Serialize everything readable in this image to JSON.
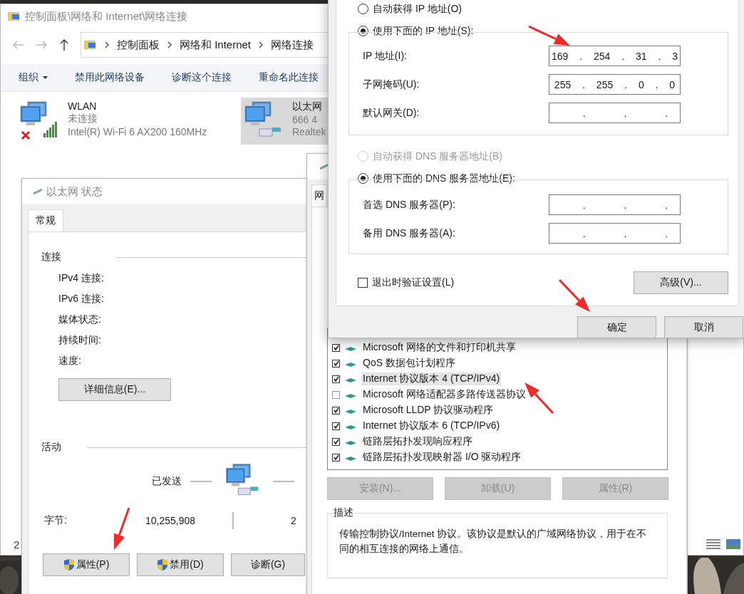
{
  "explorer": {
    "title": "控制面板\\网络和 Internet\\网络连接",
    "breadcrumb": [
      "控制面板",
      "网络和 Internet",
      "网络连接"
    ],
    "toolbar": [
      {
        "label": "组织",
        "kind": "menu"
      },
      {
        "label": "禁用此网络设备",
        "kind": "action"
      },
      {
        "label": "诊断这个连接",
        "kind": "action"
      },
      {
        "label": "重命名此连接",
        "kind": "action"
      }
    ],
    "connections": [
      {
        "name": "WLAN",
        "status": "未连接",
        "device": "Intel(R) Wi-Fi 6 AX200 160MHz",
        "kind": "wireless",
        "connected": false,
        "selected": false
      },
      {
        "name": "以太网",
        "status": "666 4",
        "device": "Realtek",
        "kind": "wired",
        "connected": true,
        "selected": true
      }
    ],
    "status_fragment": "2"
  },
  "status_window": {
    "title": "以太网 状态",
    "tabs": [
      {
        "label": "常规",
        "selected": true
      }
    ],
    "connection_group": "连接",
    "fields": [
      "IPv4 连接:",
      "IPv6 连接:",
      "媒体状态:",
      "持续时间:",
      "速度:"
    ],
    "details_button": "详细信息(E)...",
    "activity_group": "活动",
    "sent_label": "已发送",
    "bytes_label": "字节:",
    "bytes_sent": "10,255,908",
    "bytes_received": "2",
    "buttons": [
      {
        "label": "属性(P)",
        "shield": true
      },
      {
        "label": "禁用(D)",
        "shield": true
      },
      {
        "label": "诊断(G)",
        "shield": false
      }
    ]
  },
  "properties_window": {
    "tab_fragment": "网",
    "components": [
      {
        "label": "Microsoft 网络的文件和打印机共享",
        "checked": true,
        "selected": false
      },
      {
        "label": "QoS 数据包计划程序",
        "checked": true,
        "selected": false
      },
      {
        "label": "Internet 协议版本 4 (TCP/IPv4)",
        "checked": true,
        "selected": true
      },
      {
        "label": "Microsoft 网络适配器多路传送器协议",
        "checked": false,
        "selected": false
      },
      {
        "label": "Microsoft LLDP 协议驱动程序",
        "checked": true,
        "selected": false
      },
      {
        "label": "Internet 协议版本 6 (TCP/IPv6)",
        "checked": true,
        "selected": false
      },
      {
        "label": "链路层拓扑发现响应程序",
        "checked": true,
        "selected": false
      },
      {
        "label": "链路层拓扑发现映射器 I/O 驱动程序",
        "checked": true,
        "selected": false
      }
    ],
    "buttons": [
      {
        "label": "安装(N)...",
        "disabled": true
      },
      {
        "label": "卸载(U)",
        "disabled": true
      },
      {
        "label": "属性(R)",
        "disabled": true
      }
    ],
    "description_group": "描述",
    "description": "传输控制协议/Internet 协议。该协议是默认的广域网络协议，用于在不同的相互连接的网络上通信。"
  },
  "ip_dialog": {
    "ip_radios": [
      {
        "label": "自动获得 IP 地址(O)",
        "selected": false,
        "disabled": false
      },
      {
        "label": "使用下面的 IP 地址(S):",
        "selected": true,
        "disabled": false
      }
    ],
    "ip_fields": [
      {
        "label": "IP 地址(I):",
        "value": "169 . 254 . 31 . 3"
      },
      {
        "label": "子网掩码(U):",
        "value": "255 . 255 . 0 . 0"
      },
      {
        "label": "默认网关(D):",
        "value": ". . ."
      }
    ],
    "dns_radios": [
      {
        "label": "自动获得 DNS 服务器地址(B)",
        "selected": false,
        "disabled": true
      },
      {
        "label": "使用下面的 DNS 服务器地址(E):",
        "selected": true,
        "disabled": false
      }
    ],
    "dns_fields": [
      {
        "label": "首选 DNS 服务器(P):",
        "value": ". . ."
      },
      {
        "label": "备用 DNS 服务器(A):",
        "value": ". . ."
      }
    ],
    "validate_checkbox": {
      "label": "退出时验证设置(L)",
      "checked": false
    },
    "advanced_button": "高级(V)...",
    "buttons": [
      "确定",
      "取消"
    ]
  }
}
